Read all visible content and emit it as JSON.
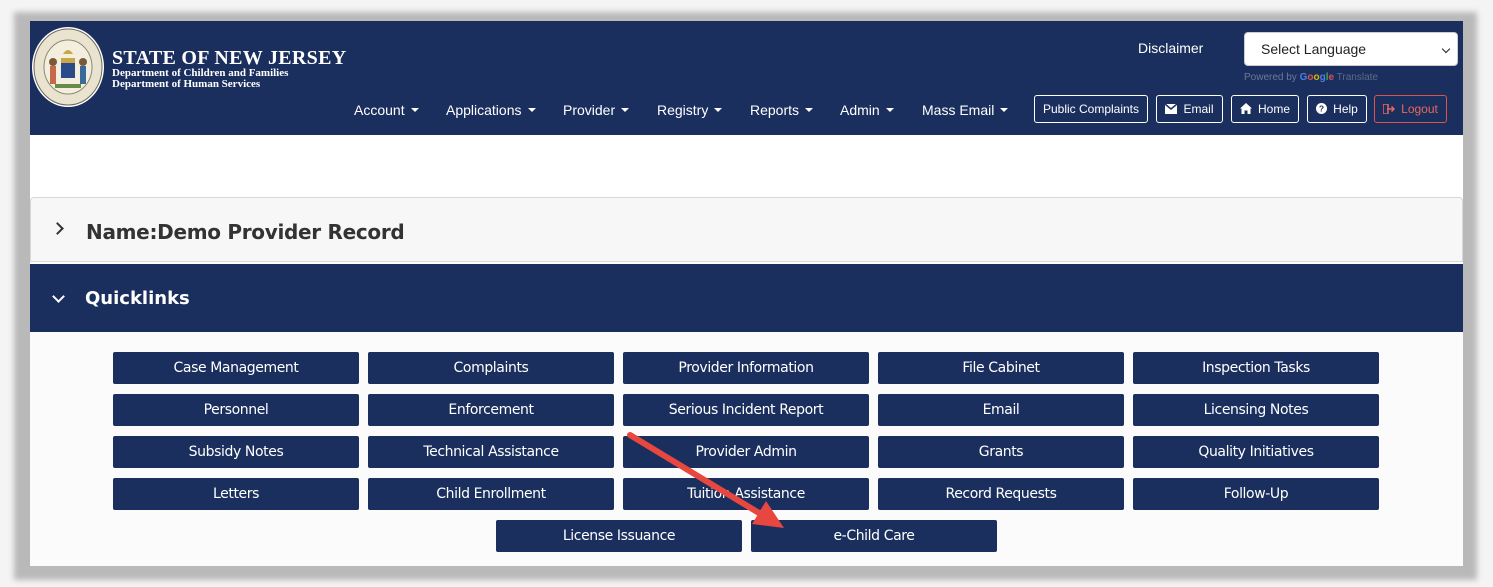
{
  "header": {
    "brand_title": "STATE OF NEW JERSEY",
    "brand_sub1": "Department of Children and Families",
    "brand_sub2": "Department of Human Services",
    "seal_icon": "nj-state-seal-icon",
    "disclaimer": "Disclaimer",
    "language_select": "Select Language",
    "powered_by": "Powered by",
    "google": [
      "G",
      "o",
      "o",
      "g",
      "l",
      "e"
    ],
    "translate": "Translate",
    "nav": [
      "Account",
      "Applications",
      "Provider",
      "Registry",
      "Reports",
      "Admin",
      "Mass Email"
    ],
    "buttons": {
      "public_complaints": "Public Complaints",
      "email": "Email",
      "home": "Home",
      "help": "Help",
      "logout": "Logout"
    }
  },
  "name_panel": {
    "label": "Name:Demo Provider Record"
  },
  "quicklinks": {
    "title": "Quicklinks",
    "rows": [
      [
        "Case Management",
        "Complaints",
        "Provider Information",
        "File Cabinet",
        "Inspection Tasks"
      ],
      [
        "Personnel",
        "Enforcement",
        "Serious Incident Report",
        "Email",
        "Licensing Notes"
      ],
      [
        "Subsidy Notes",
        "Technical Assistance",
        "Provider Admin",
        "Grants",
        "Quality Initiatives"
      ],
      [
        "Letters",
        "Child Enrollment",
        "Tuition Assistance",
        "Record Requests",
        "Follow-Up"
      ],
      [
        "License Issuance",
        "e-Child Care"
      ]
    ]
  },
  "colors": {
    "navy": "#1b2f5e",
    "annotation_arrow": "#e8473f",
    "logout": "#d9534f"
  }
}
